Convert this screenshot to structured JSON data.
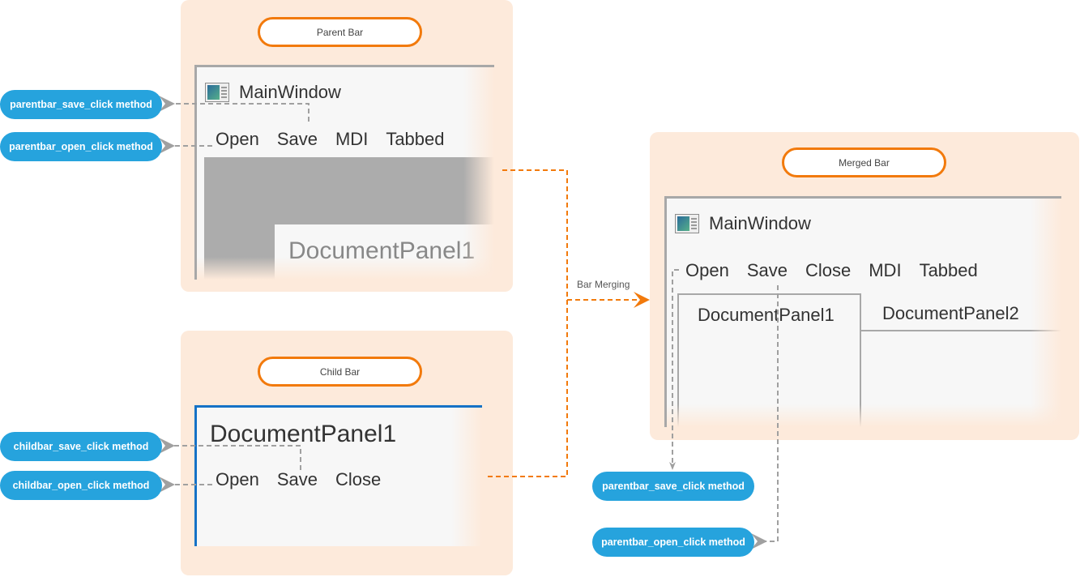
{
  "parent_bar": {
    "label": "Parent Bar",
    "window_title": "MainWindow",
    "menu": [
      "Open",
      "Save",
      "MDI",
      "Tabbed"
    ],
    "document_panel": "DocumentPanel1"
  },
  "child_bar": {
    "label": "Child Bar",
    "panel_title": "DocumentPanel1",
    "menu": [
      "Open",
      "Save",
      "Close"
    ]
  },
  "merged_bar": {
    "label": "Merged Bar",
    "window_title": "MainWindow",
    "menu": [
      "Open",
      "Save",
      "Close",
      "MDI",
      "Tabbed"
    ],
    "tabs": [
      "DocumentPanel1",
      "DocumentPanel2"
    ]
  },
  "connector_label": "Bar Merging",
  "methods": {
    "parent_save": "parentbar_save_click method",
    "parent_open": "parentbar_open_click method",
    "child_save": "childbar_save_click method",
    "child_open": "childbar_open_click method",
    "merged_save": "parentbar_save_click method",
    "merged_open": "parentbar_open_click method"
  },
  "colors": {
    "panel_bg": "#fdeadb",
    "accent_orange": "#f27a0c",
    "method_blue": "#26a3dd",
    "connector_gray": "#a0a0a0",
    "child_border_blue": "#1572c6"
  }
}
